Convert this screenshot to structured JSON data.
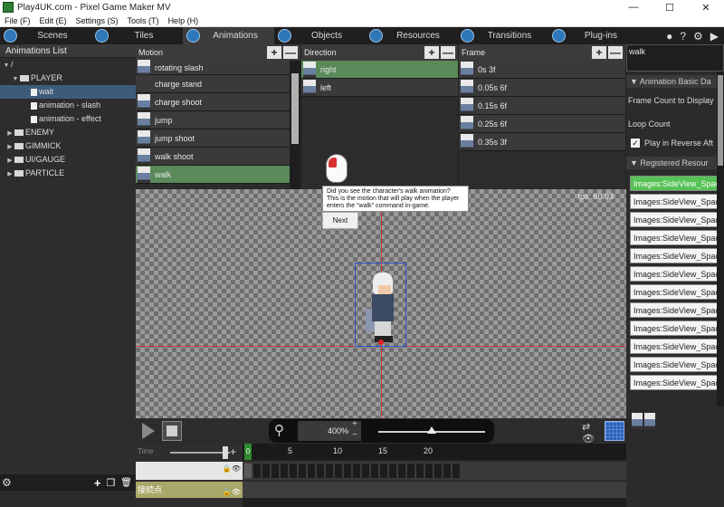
{
  "window": {
    "title": "Play4UK.com - Pixel Game Maker MV",
    "minimize": "—",
    "maximize": "☐",
    "close": "✕"
  },
  "menu": [
    "File (F)",
    "Edit (E)",
    "Settings (S)",
    "Tools (T)",
    "Help (H)"
  ],
  "tabs": [
    {
      "label": "Scenes"
    },
    {
      "label": "Tiles"
    },
    {
      "label": "Animations",
      "active": true
    },
    {
      "label": "Objects"
    },
    {
      "label": "Resources"
    },
    {
      "label": "Transitions"
    },
    {
      "label": "Plug-ins"
    }
  ],
  "tabbar_right": {
    "pin": "●",
    "help": "?",
    "gear": "⚙",
    "menu": "▶"
  },
  "animations_panel": {
    "title": "Animations List",
    "tree": [
      {
        "label": "/",
        "depth": 0,
        "type": "root",
        "tri": "▼"
      },
      {
        "label": "PLAYER",
        "depth": 1,
        "type": "folder",
        "tri": "▼"
      },
      {
        "label": "wait",
        "depth": 2,
        "type": "anim",
        "selected": true
      },
      {
        "label": "animation - slash",
        "depth": 2,
        "type": "anim"
      },
      {
        "label": "animation - effect",
        "depth": 2,
        "type": "anim"
      },
      {
        "label": "ENEMY",
        "depth": 1,
        "type": "folder",
        "tri": "▶"
      },
      {
        "label": "GIMMICK",
        "depth": 1,
        "type": "folder",
        "tri": "▶"
      },
      {
        "label": "UI/GAUGE",
        "depth": 1,
        "type": "folder",
        "tri": "▶"
      },
      {
        "label": "PARTICLE",
        "depth": 1,
        "type": "folder",
        "tri": "▶"
      }
    ],
    "bottom_icons": {
      "gear": "⚙",
      "add": "+",
      "copy": "❐",
      "delete": "🗑"
    }
  },
  "motion": {
    "title": "Motion",
    "plus": "+",
    "minus": "—",
    "items": [
      {
        "label": "rotating slash",
        "sprite": true
      },
      {
        "label": "charge stand",
        "sprite": false
      },
      {
        "label": "charge shoot",
        "sprite": true
      },
      {
        "label": "jump",
        "sprite": true
      },
      {
        "label": "jump shoot",
        "sprite": true
      },
      {
        "label": "walk shoot",
        "sprite": true
      },
      {
        "label": "walk",
        "sprite": true,
        "selected": true
      }
    ]
  },
  "direction": {
    "title": "Direction",
    "plus": "+",
    "minus": "—",
    "items": [
      {
        "label": "right",
        "selected": true
      },
      {
        "label": "left"
      }
    ]
  },
  "frame": {
    "title": "Frame",
    "plus": "+",
    "minus": "—",
    "items": [
      {
        "label": "0s 3f"
      },
      {
        "label": "0.05s 6f"
      },
      {
        "label": "0.15s 6f"
      },
      {
        "label": "0.25s 6f"
      },
      {
        "label": "0.35s 3f"
      }
    ]
  },
  "canvas": {
    "fps": "fps: 60.93"
  },
  "tooltip": {
    "line1": "Did you see the character's walk animation?",
    "line2": "This is the motion that will play when the player",
    "line3": "enters the \"walk\" command in-game.",
    "next": "Next"
  },
  "zoom": {
    "value": "400%",
    "plus": "+",
    "minus": "−",
    "icon": "⚲"
  },
  "timeline": {
    "time_label": "Time",
    "plus": "+",
    "ruler": [
      "0",
      "5",
      "10",
      "15",
      "20"
    ],
    "track_label": "接続点",
    "lock": "🔒",
    "eye": "👁"
  },
  "right_panel": {
    "search_value": "walk",
    "section_title": "Animation Basic Da",
    "frame_count_label": "Frame Count to Display",
    "loop_count_label": "Loop Count",
    "reverse_label": "Play in Reverse Aft",
    "reverse_checked": "✓",
    "registered_title": "Registered Resour",
    "resources": [
      "Images:SideView_Spac",
      "Images:SideView_Spac",
      "Images:SideView_Spac",
      "Images:SideView_Spac",
      "Images:SideView_Spac",
      "Images:SideView_Spac",
      "Images:SideView_Spac",
      "Images:SideView_Spac",
      "Images:SideView_Spac",
      "Images:SideView_Spac",
      "Images:SideView_Spac",
      "Images:SideView_Spac",
      "Images:SideView_Spac",
      "Images:SideView_Spac"
    ]
  },
  "colors": {
    "accent_selected": "#5a8a5a",
    "resource_selected": "#56c256",
    "axis": "#c83a3a",
    "tab_icon": "#2e77b8"
  }
}
